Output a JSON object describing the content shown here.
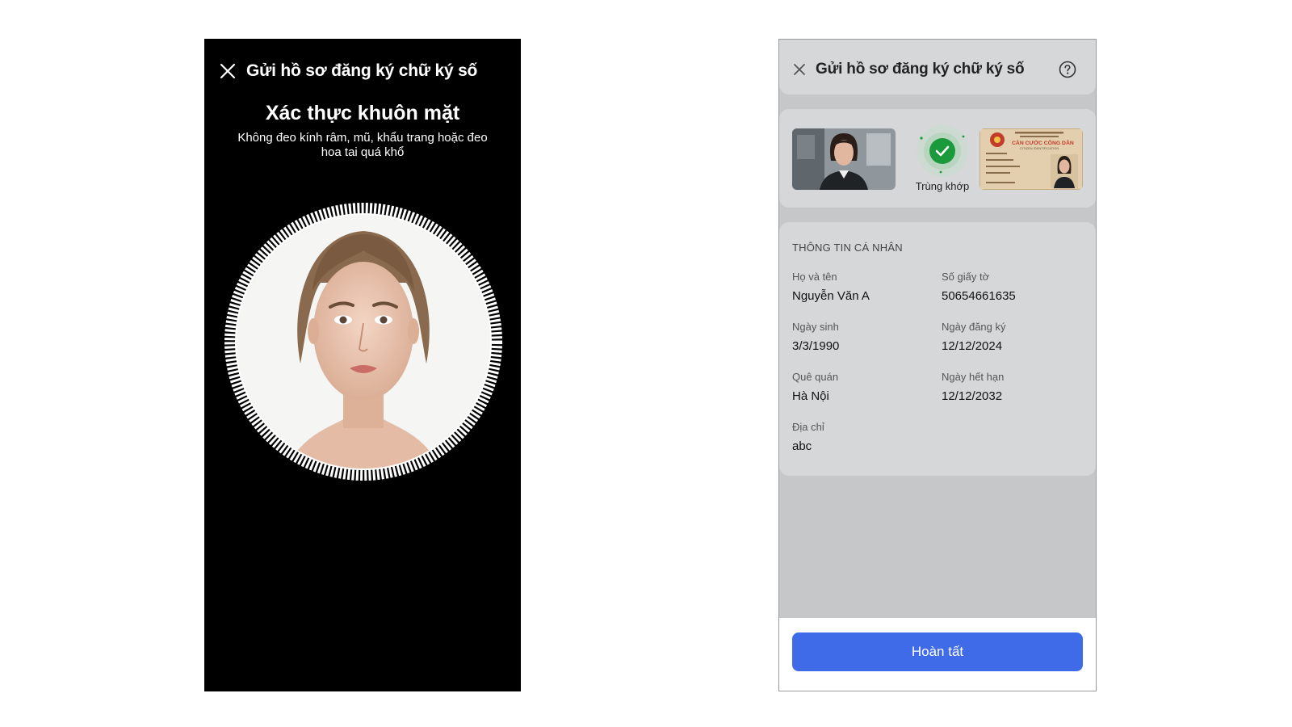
{
  "left_screen": {
    "header": {
      "title": "Gửi hồ sơ đăng ký chữ ký số"
    },
    "heading": "Xác thực khuôn mặt",
    "hint": "Không đeo kính râm, mũ, khẩu trang hoặc đeo hoa tai quá khổ",
    "colors": {
      "background": "#000000",
      "text": "#ffffff"
    }
  },
  "right_screen": {
    "header": {
      "title": "Gửi hồ sơ đăng ký chữ ký số"
    },
    "match": {
      "status_label": "Trùng khớp",
      "id_card_heading": "CĂN CƯỚC CÔNG DÂN",
      "id_card_subheading": "CITIZEN IDENTIFICATION"
    },
    "personal_info": {
      "section_title": "THÔNG TIN CÁ NHÂN",
      "fields": [
        {
          "label": "Họ và tên",
          "value": "Nguyễn Văn A"
        },
        {
          "label": "Số giấy tờ",
          "value": "50654661635"
        },
        {
          "label": "Ngày sinh",
          "value": "3/3/1990"
        },
        {
          "label": "Ngày đăng ký",
          "value": "12/12/2024"
        },
        {
          "label": "Quê quán",
          "value": "Hà Nội"
        },
        {
          "label": "Ngày hết hạn",
          "value": "12/12/2032"
        },
        {
          "label": "Địa chỉ",
          "value": "abc"
        }
      ]
    },
    "footer": {
      "done_label": "Hoàn tất"
    },
    "colors": {
      "accent": "#3f6ae8",
      "success": "#1a9a3a",
      "overlay": "#c6c7c9"
    }
  }
}
